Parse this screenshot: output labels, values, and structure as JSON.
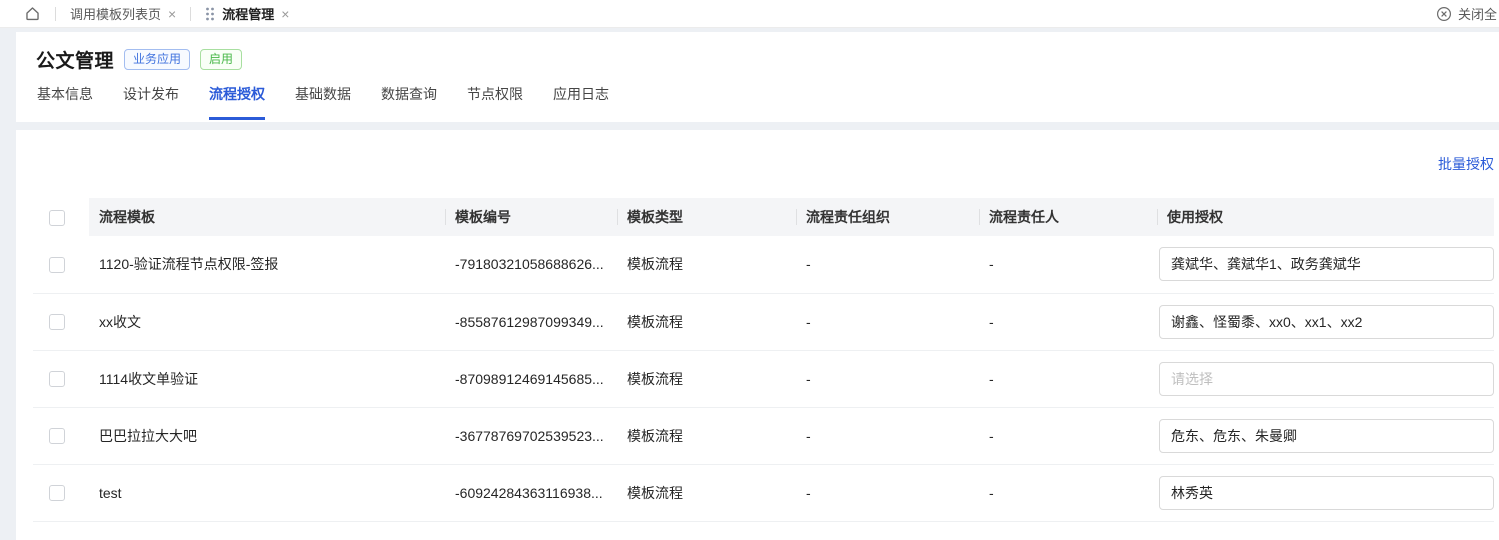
{
  "topbar": {
    "tabs": [
      {
        "label": "调用模板列表页"
      },
      {
        "label": "流程管理"
      }
    ],
    "close_all_label": "关闭全",
    "icons": {
      "close_glyph": "×"
    }
  },
  "page": {
    "title": "公文管理",
    "badges": [
      {
        "label": "业务应用",
        "type": "blue"
      },
      {
        "label": "启用",
        "type": "green"
      }
    ],
    "tabs": [
      {
        "label": "基本信息"
      },
      {
        "label": "设计发布"
      },
      {
        "label": "流程授权"
      },
      {
        "label": "基础数据"
      },
      {
        "label": "数据查询"
      },
      {
        "label": "节点权限"
      },
      {
        "label": "应用日志"
      }
    ],
    "active_tab": "流程授权"
  },
  "panel": {
    "batch_auth_label": "批量授权",
    "columns": [
      "流程模板",
      "模板编号",
      "模板类型",
      "流程责任组织",
      "流程责任人",
      "使用授权"
    ],
    "rows": [
      {
        "template": "1120-验证流程节点权限-签报",
        "code": "-79180321058688626...",
        "type": "模板流程",
        "org": "-",
        "owner": "-",
        "auth_value": "龚斌华、龚斌华1、政务龚斌华",
        "auth_placeholder": ""
      },
      {
        "template": "xx收文",
        "code": "-85587612987099349...",
        "type": "模板流程",
        "org": "-",
        "owner": "-",
        "auth_value": "谢鑫、怪蜀黍、xx0、xx1、xx2",
        "auth_placeholder": ""
      },
      {
        "template": "1114收文单验证",
        "code": "-87098912469145685...",
        "type": "模板流程",
        "org": "-",
        "owner": "-",
        "auth_value": "",
        "auth_placeholder": "请选择"
      },
      {
        "template": "巴巴拉拉大大吧",
        "code": "-36778769702539523...",
        "type": "模板流程",
        "org": "-",
        "owner": "-",
        "auth_value": "危东、危东、朱曼卿",
        "auth_placeholder": ""
      },
      {
        "template": "test",
        "code": "-60924284363116938...",
        "type": "模板流程",
        "org": "-",
        "owner": "-",
        "auth_value": "林秀英",
        "auth_placeholder": ""
      }
    ]
  },
  "colors": {
    "accent_blue": "#2b5bd8",
    "badge_blue": "#4173de",
    "badge_green": "#49b849",
    "header_bg": "#f4f5f7",
    "page_bg": "#edf0f4"
  }
}
